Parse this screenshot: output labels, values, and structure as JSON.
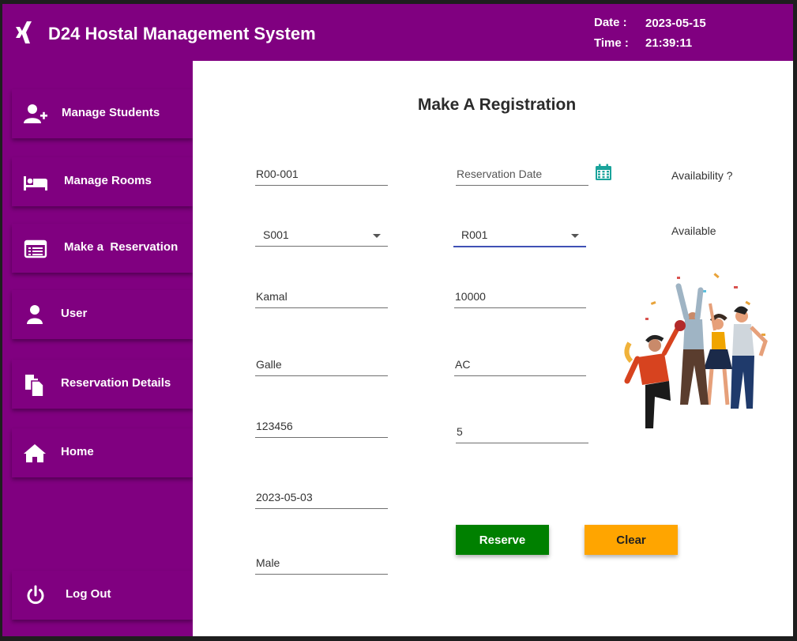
{
  "header": {
    "title": "D24 Hostal Management System",
    "date_label": "Date :",
    "date_value": "2023-05-15",
    "time_label": "Time :",
    "time_value": "21:39:11",
    "logo_icon": "xing-logo-icon",
    "bg_color": "#800080"
  },
  "sidebar": {
    "items": [
      {
        "label": "Manage Students",
        "icon": "user-plus-icon"
      },
      {
        "label": "Manage Rooms",
        "icon": "bed-icon"
      },
      {
        "label": "Make a  Reservation",
        "icon": "list-card-icon"
      },
      {
        "label": "User",
        "icon": "user-icon"
      },
      {
        "label": "Reservation Details",
        "icon": "documents-icon"
      },
      {
        "label": "Home",
        "icon": "home-icon"
      }
    ],
    "logout": {
      "label": "Log Out",
      "icon": "power-icon"
    }
  },
  "form": {
    "title": "Make A Registration",
    "reservation_id": "R00-001",
    "student_id": "S001",
    "student_name": "Kamal",
    "address": "Galle",
    "contact": "123456",
    "dob": "2023-05-03",
    "gender": "Male",
    "reservation_date_placeholder": "Reservation Date",
    "room_id": "R001",
    "key_money": "10000",
    "room_type": "AC",
    "qty": "5",
    "availability_label": "Availability ?",
    "availability_value": "Available",
    "reserve_label": "Reserve",
    "clear_label": "Clear"
  },
  "colors": {
    "accent": "#800080",
    "reserve": "#008000",
    "clear": "#ffa500",
    "focus": "#3f51b5",
    "calendar": "#1aa39b"
  }
}
